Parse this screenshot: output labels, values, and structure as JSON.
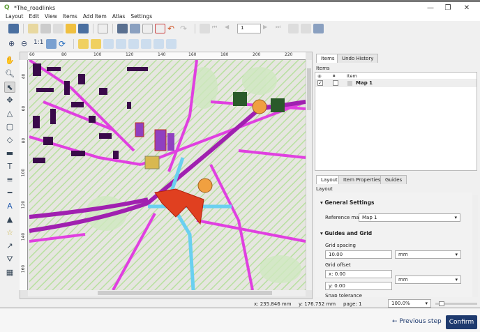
{
  "window": {
    "title": "*The_roadlinks",
    "minimize": "—",
    "maximize": "❐",
    "close": "✕"
  },
  "menu": [
    "Layout",
    "Edit",
    "View",
    "Items",
    "Add Item",
    "Atlas",
    "Settings"
  ],
  "toolbar": {
    "page_field": "1"
  },
  "rulers": {
    "top": [
      "60",
      "80",
      "100",
      "120",
      "140",
      "160",
      "180",
      "200",
      "220"
    ],
    "left": [
      "40",
      "60",
      "80",
      "100",
      "120",
      "140",
      "160"
    ]
  },
  "items_panel": {
    "tabs": [
      "Items",
      "Undo History"
    ],
    "title": "Items",
    "columns": [
      "",
      "",
      "Item"
    ],
    "rows": [
      {
        "visible": true,
        "locked": false,
        "name": "Map 1"
      }
    ]
  },
  "layout_panel": {
    "tabs": [
      "Layout",
      "Item Properties",
      "Guides"
    ],
    "title": "Layout",
    "general_settings": {
      "heading": "General Settings",
      "reference_map_label": "Reference map",
      "reference_map": "Map 1"
    },
    "guides_grid": {
      "heading": "Guides and Grid",
      "grid_spacing_label": "Grid spacing",
      "grid_spacing": "10.00",
      "grid_spacing_unit": "mm",
      "grid_offset_label": "Grid offset",
      "offset_x": "x: 0.00",
      "offset_y": "y: 0.00",
      "offset_unit": "mm",
      "snap_tolerance_label": "Snap tolerance"
    }
  },
  "status": {
    "x": "x: 235.846 mm",
    "y": "y: 176.752 mm",
    "page": "page: 1",
    "zoom": "100.0%"
  },
  "footer": {
    "previous": "Previous step",
    "confirm": "Confirm"
  },
  "colors": {
    "roads": "#e040e0",
    "buildings": "#3a0a4a",
    "highway": "#6ad0f0",
    "accent": "#1e3a6e",
    "circles": "#f0a040",
    "squares": "#2a5a2a"
  }
}
